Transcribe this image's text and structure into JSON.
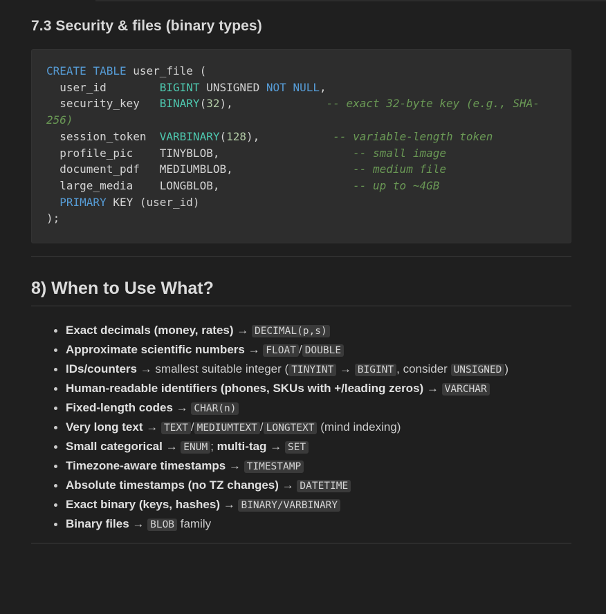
{
  "section_7_3": {
    "title": "7.3 Security & files (binary types)",
    "code": {
      "l1": {
        "kw1": "CREATE",
        "kw2": "TABLE",
        "rest": " user_file ("
      },
      "l2": {
        "col": "  user_id        ",
        "ty": "BIGINT",
        "rest": " UNSIGNED ",
        "kw1": "NOT",
        "kw2": "NULL",
        "end": ","
      },
      "l3": {
        "col": "  security_key   ",
        "ty": "BINARY",
        "p1": "(",
        "num": "32",
        "p2": "),              ",
        "cm": "-- exact 32-byte key (e.g., SHA-"
      },
      "l4": {
        "cm": "256)"
      },
      "l5": {
        "col": "  session_token  ",
        "ty": "VARBINARY",
        "p1": "(",
        "num": "128",
        "p2": "),           ",
        "cm": "-- variable-length token"
      },
      "l6": {
        "col": "  profile_pic    ",
        "rest": "TINYBLOB,                    ",
        "cm": "-- small image"
      },
      "l7": {
        "col": "  document_pdf   ",
        "rest": "MEDIUMBLOB,                  ",
        "cm": "-- medium file"
      },
      "l8": {
        "col": "  large_media    ",
        "rest": "LONGBLOB,                    ",
        "cm": "-- up to ~4GB"
      },
      "l9": {
        "indent": "  ",
        "kw1": "PRIMARY",
        "rest": " KEY (user_id)"
      },
      "l10": {
        "rest": ");"
      }
    }
  },
  "section_8": {
    "title": "8) When to Use What?",
    "items": [
      {
        "b": "Exact decimals (money, rates)",
        "arrow": " → ",
        "c1": "DECIMAL(p,s)"
      },
      {
        "b": "Approximate scientific numbers",
        "arrow": " → ",
        "c1": "FLOAT",
        "sep": "/",
        "c2": "DOUBLE"
      },
      {
        "b": "IDs/counters",
        "t1": " → smallest suitable integer (",
        "c1": "TINYINT",
        "arrow": " → ",
        "c2": "BIGINT",
        "t2": ", consider ",
        "c3": "UNSIGNED",
        "t3": ")"
      },
      {
        "b": "Human-readable identifiers (phones, SKUs with +/leading zeros)",
        "arrow": " → ",
        "c1": "VARCHAR"
      },
      {
        "b": "Fixed-length codes",
        "arrow": " → ",
        "c1": "CHAR(n)"
      },
      {
        "b": "Very long text",
        "arrow": " → ",
        "c1": "TEXT",
        "sep1": "/",
        "c2": "MEDIUMTEXT",
        "sep2": "/",
        "c3": "LONGTEXT",
        "t1": " (mind indexing)"
      },
      {
        "b": "Small categorical",
        "arrow": " → ",
        "c1": "ENUM",
        "t1": "; ",
        "b2": "multi-tag",
        "arrow2": " → ",
        "c2": "SET"
      },
      {
        "b": "Timezone-aware timestamps",
        "arrow": " → ",
        "c1": "TIMESTAMP"
      },
      {
        "b": "Absolute timestamps (no TZ changes)",
        "arrow": " → ",
        "c1": "DATETIME"
      },
      {
        "b": "Exact binary (keys, hashes)",
        "arrow": " → ",
        "c1": "BINARY/VARBINARY"
      },
      {
        "b": "Binary files",
        "arrow": " → ",
        "c1": "BLOB",
        "t1": " family"
      }
    ]
  }
}
